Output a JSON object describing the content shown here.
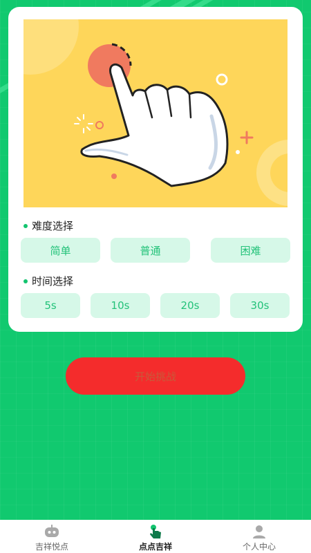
{
  "colors": {
    "background": "#11c96f",
    "card": "#ffffff",
    "hero_bg": "#fed65a",
    "chip_bg": "#d6f8e8",
    "chip_text": "#23c279",
    "accent_dot": "#13c46f",
    "start_button": "#f42c2c"
  },
  "hero": {
    "icon": "pointing-hand-tap-illustration"
  },
  "difficulty": {
    "title": "难度选择",
    "options": [
      "简单",
      "普通",
      "困难"
    ]
  },
  "time": {
    "title": "时间选择",
    "options": [
      "5s",
      "10s",
      "20s",
      "30s"
    ]
  },
  "start_button": {
    "label": "开始挑战"
  },
  "tabbar": {
    "tabs": [
      {
        "label": "吉祥悦点",
        "icon": "robot-face-icon",
        "active": false
      },
      {
        "label": "点点吉祥",
        "icon": "tap-hand-icon",
        "active": true
      },
      {
        "label": "个人中心",
        "icon": "person-icon",
        "active": false
      }
    ]
  }
}
